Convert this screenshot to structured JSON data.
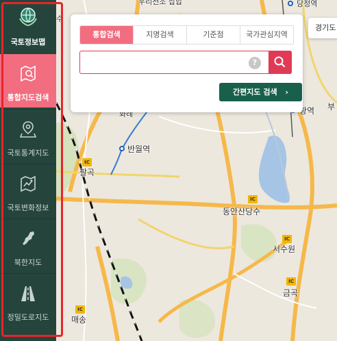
{
  "sidebar": {
    "logo": {
      "icon": "globe-leaf-icon",
      "label": "국토정보맵"
    },
    "items": [
      {
        "label": "통합지도검색",
        "icon": "map-search-icon",
        "active": true
      },
      {
        "label": "국토통계지도",
        "icon": "map-pin-icon",
        "active": false
      },
      {
        "label": "국토변화정보",
        "icon": "map-change-icon",
        "active": false
      },
      {
        "label": "북한지도",
        "icon": "north-korea-icon",
        "active": false
      },
      {
        "label": "정밀도로지도",
        "icon": "road-icon",
        "active": false
      }
    ],
    "colors": {
      "background": "#25453c",
      "active": "#f26d80",
      "highlight_outline": "#e6252b"
    }
  },
  "search_panel": {
    "tabs": [
      {
        "label": "통합검색",
        "active": true
      },
      {
        "label": "지명검색",
        "active": false
      },
      {
        "label": "기준점",
        "active": false
      },
      {
        "label": "국가관심지역",
        "active": false
      }
    ],
    "input_value": "",
    "help_label": "?",
    "search_icon": "search-icon",
    "simple_search_label": "간편지도 검색",
    "simple_search_icon": "chevron-right-icon",
    "colors": {
      "accent": "#e13a55",
      "button": "#18604c"
    }
  },
  "region_chip": {
    "label": "경기도"
  },
  "map": {
    "labels": {
      "station_top": "당정역",
      "top_left_partial": "수",
      "top_road_partial": "우리전조 삽압",
      "region": "화례",
      "station_banwol": "반월역",
      "ic_palgok": "팔곡",
      "dongan": "동안산당수",
      "seosuwon": "서수원",
      "geumgok": "금곡",
      "maesong": "매송",
      "station_right": "왕역",
      "right_edge": "부"
    },
    "ic_label": "IC"
  }
}
